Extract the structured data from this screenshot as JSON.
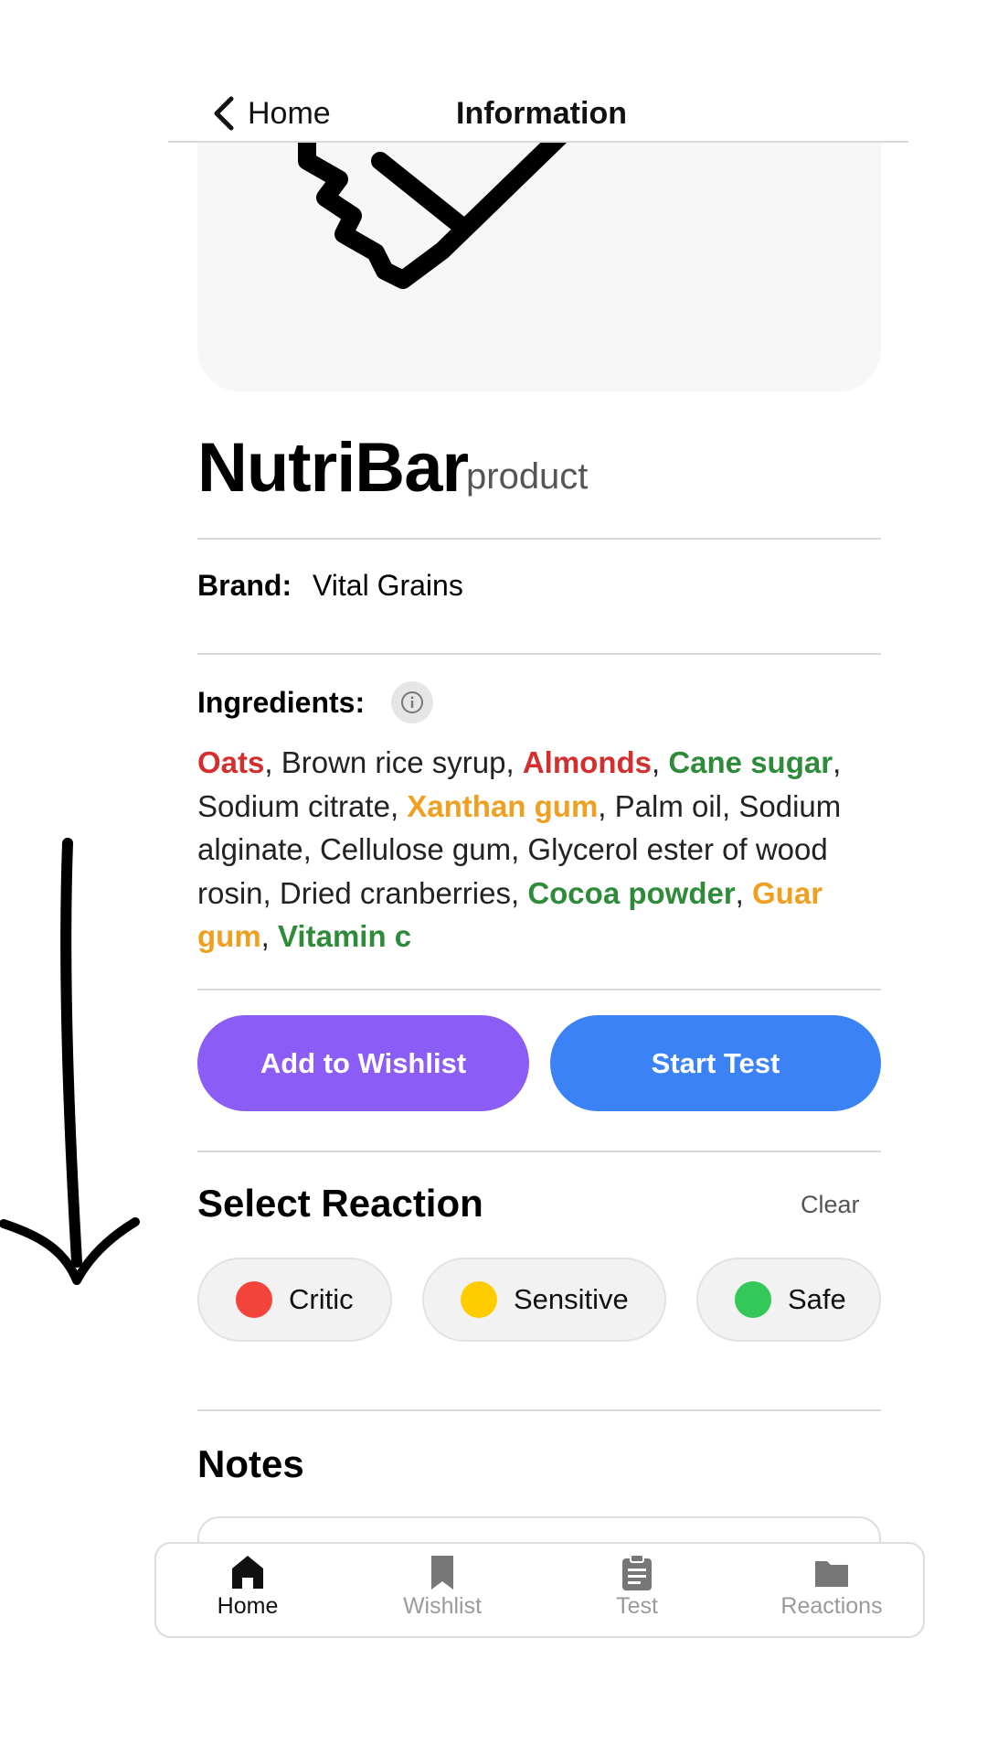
{
  "header": {
    "back_label": "Home",
    "title": "Information"
  },
  "product": {
    "name": "NutriBar",
    "type": "product",
    "brand_label": "Brand:",
    "brand_value": "Vital Grains",
    "ingredients_label": "Ingredients:",
    "ingredients": [
      {
        "text": "Oats",
        "status": "critic"
      },
      {
        "text": "Brown rice syrup",
        "status": "none"
      },
      {
        "text": "Almonds",
        "status": "critic"
      },
      {
        "text": "Cane sugar",
        "status": "safe"
      },
      {
        "text": "Sodium citrate",
        "status": "none"
      },
      {
        "text": "Xanthan gum",
        "status": "sensitive"
      },
      {
        "text": "Palm oil",
        "status": "none"
      },
      {
        "text": "Sodium alginate",
        "status": "none"
      },
      {
        "text": "Cellulose gum",
        "status": "none"
      },
      {
        "text": "Glycerol ester of wood rosin",
        "status": "none"
      },
      {
        "text": "Dried cranberries",
        "status": "none"
      },
      {
        "text": "Cocoa powder",
        "status": "safe"
      },
      {
        "text": "Guar gum",
        "status": "sensitive"
      },
      {
        "text": "Vitamin c",
        "status": "safe"
      }
    ]
  },
  "actions": {
    "wishlist_label": "Add to Wishlist",
    "start_test_label": "Start Test"
  },
  "reaction": {
    "title": "Select Reaction",
    "clear_label": "Clear",
    "options": [
      {
        "label": "Critic",
        "color": "#f4433a"
      },
      {
        "label": "Sensitive",
        "color": "#ffcc00"
      },
      {
        "label": "Safe",
        "color": "#34c759"
      }
    ]
  },
  "notes": {
    "title": "Notes"
  },
  "bottom_nav": {
    "items": [
      {
        "label": "Home",
        "icon": "home-icon",
        "active": true
      },
      {
        "label": "Wishlist",
        "icon": "bookmark-icon",
        "active": false
      },
      {
        "label": "Test",
        "icon": "clipboard-icon",
        "active": false
      },
      {
        "label": "Reactions",
        "icon": "folder-icon",
        "active": false
      }
    ]
  },
  "colors": {
    "wishlist_button": "#8b5cf6",
    "start_test_button": "#3b82f6",
    "critic_text": "#d32f2f",
    "safe_text": "#2e8b3a",
    "sensitive_text": "#f0a020"
  }
}
